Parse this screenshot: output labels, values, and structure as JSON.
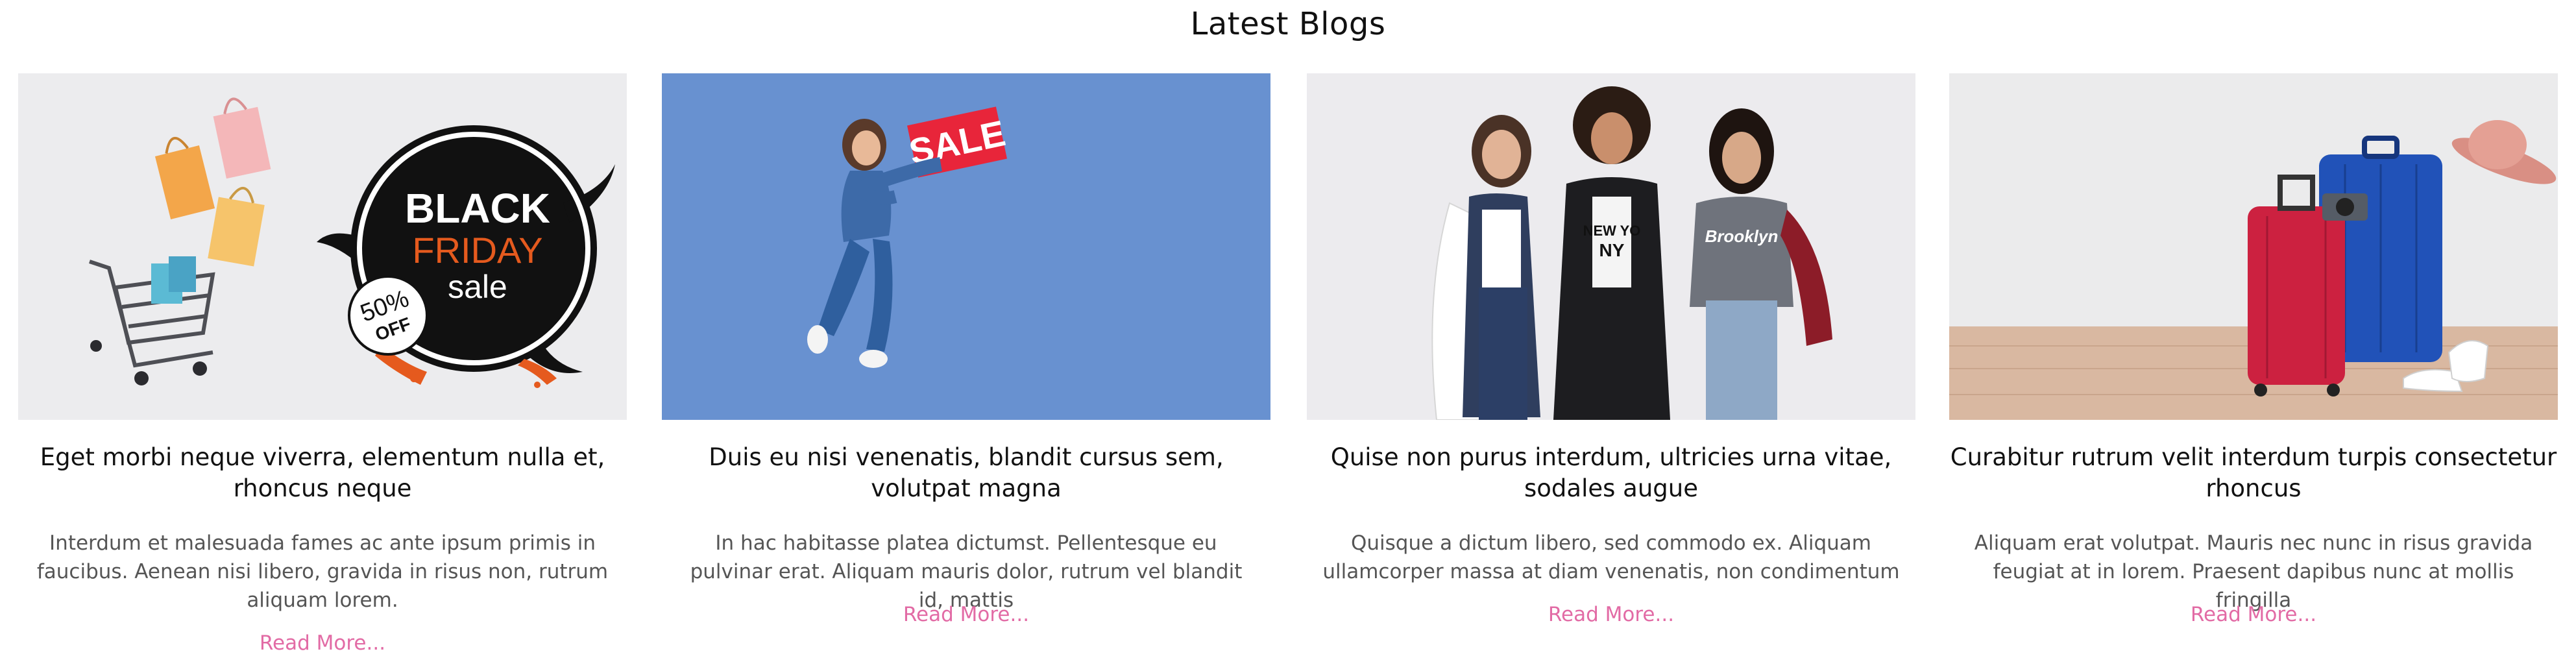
{
  "section": {
    "title": "Latest Blogs"
  },
  "posts": [
    {
      "title": "Eget morbi neque viverra, elementum nulla et, rhoncus neque",
      "excerpt": "Interdum et malesuada fames ac ante ipsum primis in faucibus. Aenean nisi libero, gravida in risus non, rutrum aliquam lorem.",
      "read_more": "Read More...",
      "image_alt": "black-friday-sale-image",
      "image_text": {
        "black": "BLACK",
        "friday": "FRIDAY",
        "sale": "sale",
        "pct": "50%",
        "off": "OFF"
      }
    },
    {
      "title": "Duis eu nisi venenatis, blandit cursus sem, volutpat magna",
      "excerpt": "In hac habitasse platea dictumst. Pellentesque eu pulvinar erat. Aliquam mauris dolor, rutrum vel blandit id, mattis",
      "read_more": "Read More...",
      "image_alt": "sale-sign-woman-image",
      "image_text": {
        "sale": "SALE"
      }
    },
    {
      "title": "Quise non purus interdum, ultricies urna vitae, sodales augue",
      "excerpt": "Quisque a dictum libero, sed commodo ex. Aliquam ullamcorper massa at diam venenatis, non condimentum",
      "read_more": "Read More...",
      "image_alt": "three-women-image",
      "image_text": {
        "shirt1": "NEW YO",
        "shirt1b": "NY",
        "shirt2": "Brooklyn"
      }
    },
    {
      "title": "Curabitur rutrum velit interdum turpis consectetur rhoncus",
      "excerpt": "Aliquam erat volutpat. Mauris nec nunc in risus gravida feugiat at in lorem. Praesent dapibus nunc at mollis fringilla",
      "read_more": "Read More...",
      "image_alt": "suitcases-travel-image"
    }
  ],
  "colors": {
    "accent": "#e26ba5",
    "text": "#111111",
    "muted": "#555555",
    "blue_bg": "#6891d0"
  }
}
